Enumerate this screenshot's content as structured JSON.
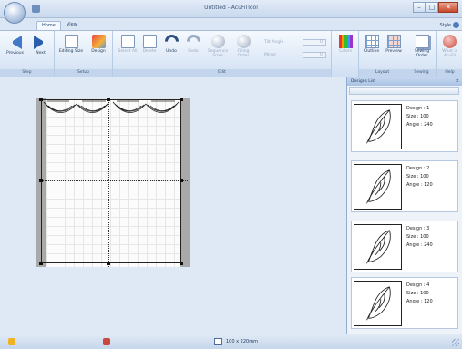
{
  "window": {
    "title": "Untitled - AcuFilTool",
    "min": "–",
    "max": "□",
    "close": "✕"
  },
  "tabs": [
    "Home",
    "View"
  ],
  "tab_style": "Style",
  "ribbon": {
    "groups": [
      {
        "label": "Step",
        "buttons": [
          "Previous",
          "Next"
        ]
      },
      {
        "label": "Setup",
        "buttons": [
          "Editing Size",
          "Design"
        ]
      },
      {
        "label": "Edit",
        "buttons": [
          "Select All",
          "Delete",
          "Undo",
          "Redo",
          "Sequence Sizes",
          "Filling Order"
        ]
      },
      {
        "label": "",
        "buttons": [
          "Colors"
        ]
      },
      {
        "label": "Layout",
        "buttons": [
          "Outline",
          "Preview"
        ]
      },
      {
        "label": "Sewing",
        "buttons": [
          "Sewing Order"
        ]
      },
      {
        "label": "Help",
        "buttons": [
          "What is AcuFil"
        ]
      }
    ],
    "fields": [
      {
        "label": "Tilt Angle",
        "value": "0"
      },
      {
        "label": "Mirror",
        "value": "0"
      }
    ]
  },
  "panel": {
    "title": "Designs List",
    "close": "×",
    "designs": [
      {
        "design": "Design : 1",
        "size": "Size : 100",
        "angle": "Angle : 240"
      },
      {
        "design": "Design : 2",
        "size": "Size : 100",
        "angle": "Angle : 120"
      },
      {
        "design": "Design : 3",
        "size": "Size : 100",
        "angle": "Angle : 240"
      },
      {
        "design": "Design : 4",
        "size": "Size : 100",
        "angle": "Angle : 120"
      }
    ]
  },
  "status": {
    "dimensions": "100 x 220mm"
  },
  "colors": {
    "accent": "#2a5fae",
    "hoop": "#a9a9a9",
    "ribbon_bg": "#dce8f6"
  }
}
